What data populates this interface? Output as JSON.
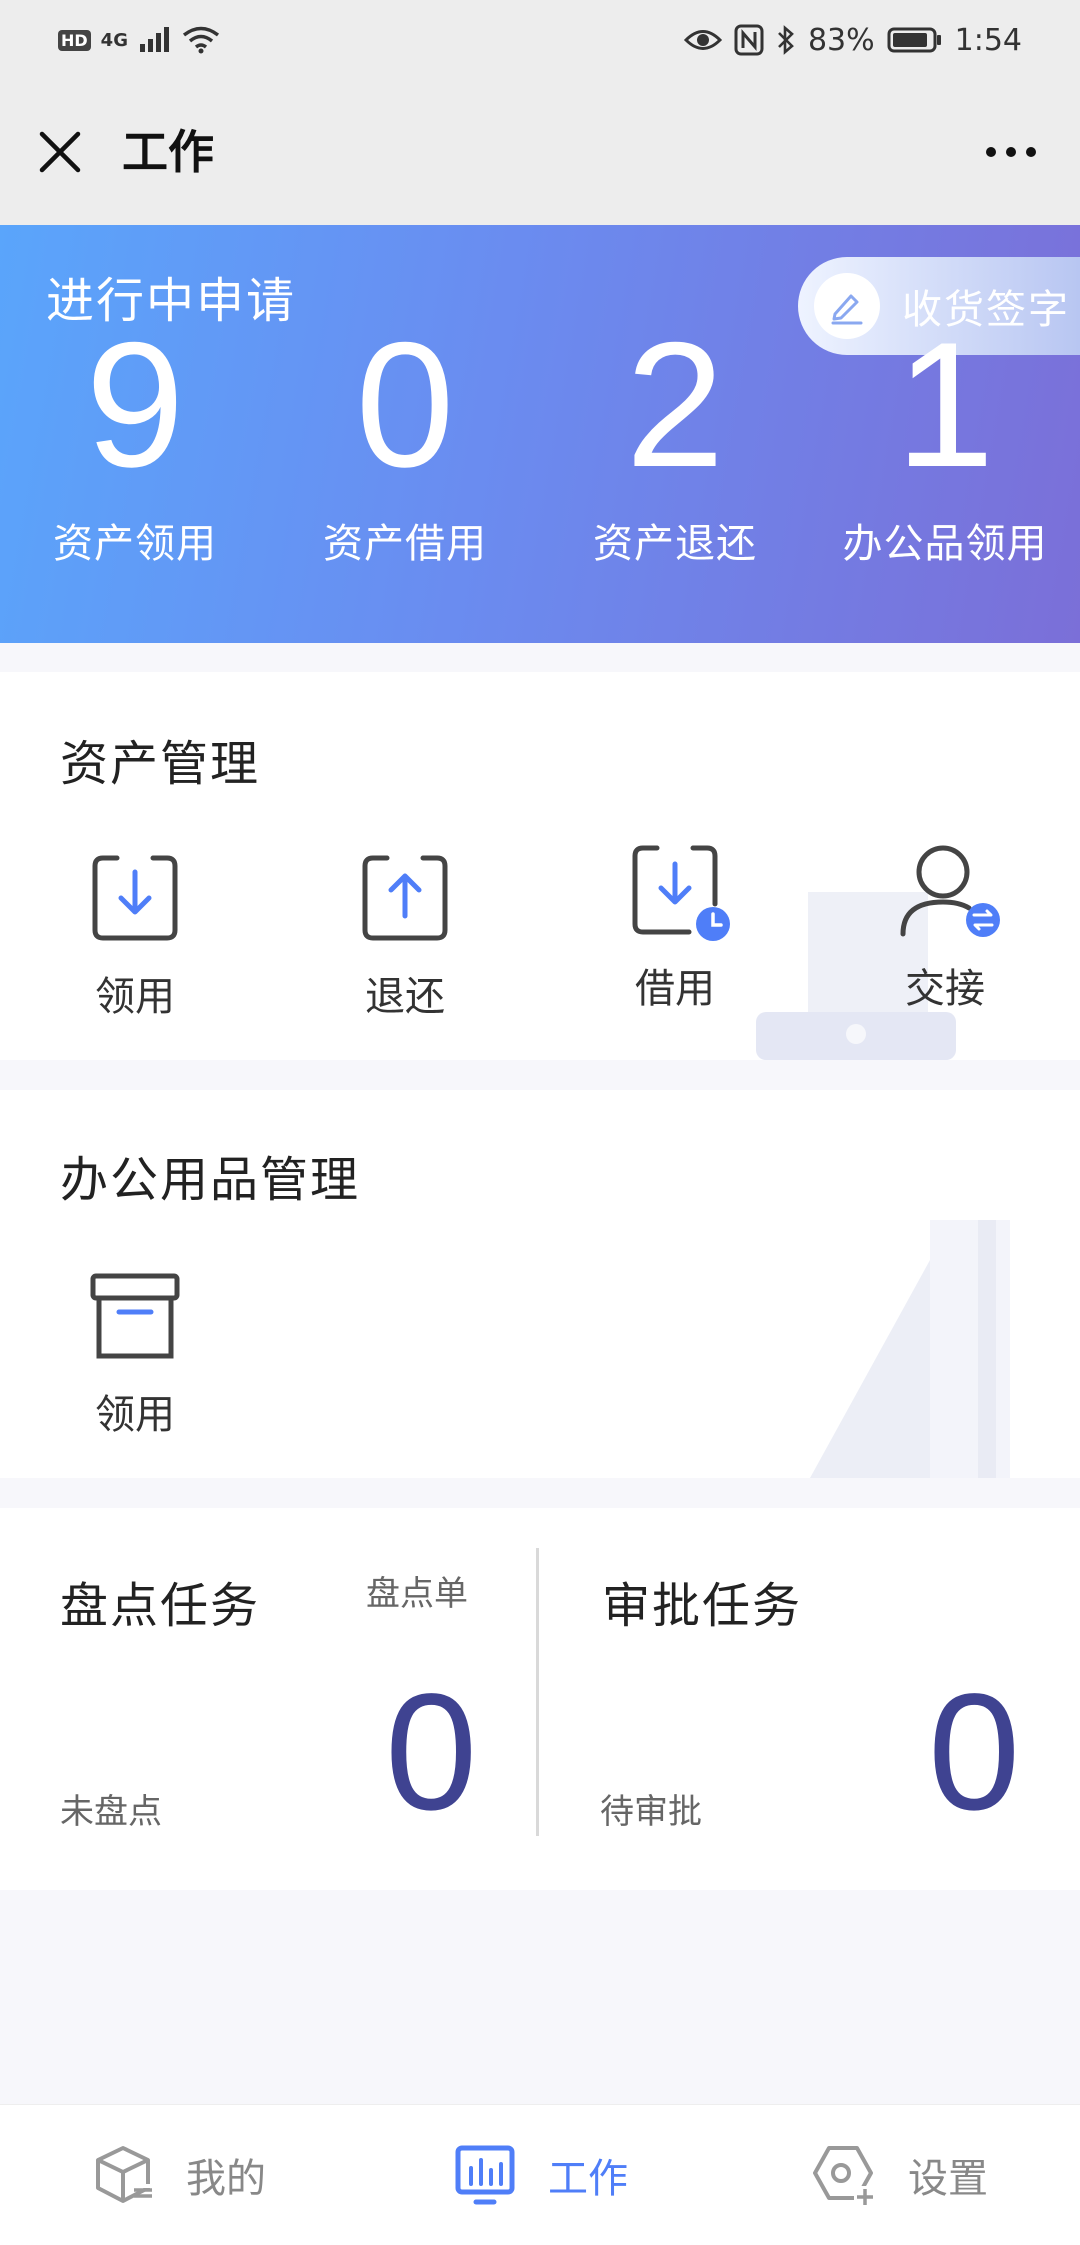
{
  "status_bar": {
    "hd": "HD",
    "network": "4G",
    "battery": "83%",
    "time": "1:54"
  },
  "header": {
    "title": "工作"
  },
  "banner": {
    "title": "进行中申请",
    "sign_button": "收货签字",
    "stats": [
      {
        "value": "9",
        "label": "资产领用"
      },
      {
        "value": "0",
        "label": "资产借用"
      },
      {
        "value": "2",
        "label": "资产退还"
      },
      {
        "value": "1",
        "label": "办公品领用"
      }
    ]
  },
  "asset_mgmt": {
    "title": "资产管理",
    "items": [
      {
        "label": "领用",
        "icon": "receive-icon"
      },
      {
        "label": "退还",
        "icon": "return-icon"
      },
      {
        "label": "借用",
        "icon": "borrow-icon"
      },
      {
        "label": "交接",
        "icon": "handover-icon"
      }
    ]
  },
  "office_mgmt": {
    "title": "办公用品管理",
    "items": [
      {
        "label": "领用",
        "icon": "box-icon"
      }
    ]
  },
  "inventory_task": {
    "title": "盘点任务",
    "link": "盘点单",
    "sub": "未盘点",
    "count": "0"
  },
  "approval_task": {
    "title": "审批任务",
    "sub": "待审批",
    "count": "0"
  },
  "tabbar": {
    "tabs": [
      {
        "label": "我的",
        "icon": "cube-icon",
        "active": false
      },
      {
        "label": "工作",
        "icon": "chart-icon",
        "active": true
      },
      {
        "label": "设置",
        "icon": "settings-icon",
        "active": false
      }
    ]
  },
  "colors": {
    "accent": "#4f7ef8",
    "task_number": "#3f4391",
    "banner_start": "#5aa5fb",
    "banner_end": "#7b6fd8"
  }
}
